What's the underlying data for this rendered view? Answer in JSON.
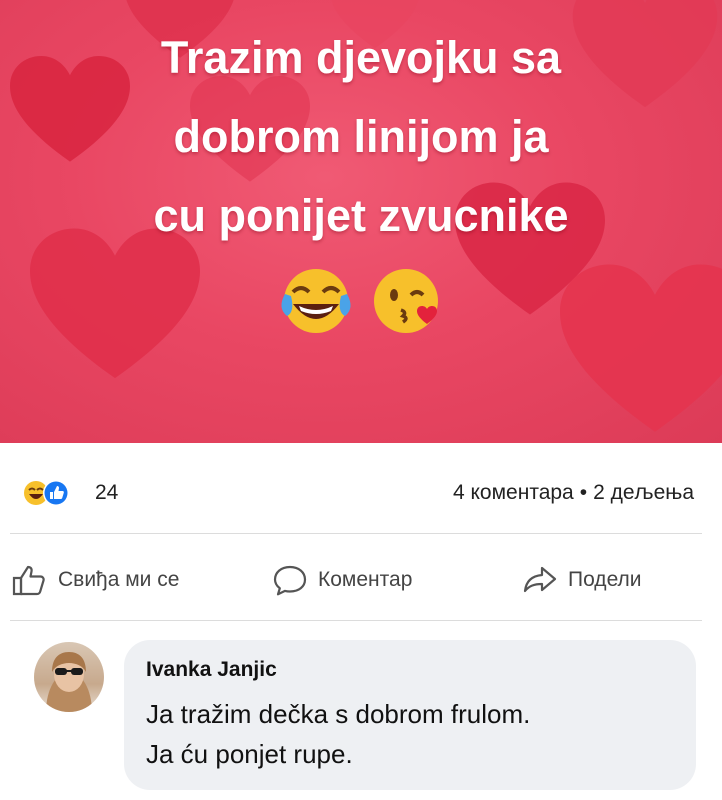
{
  "post": {
    "image_text_lines": [
      "Trazim djevojku sa",
      "dobrom linijom ja",
      "cu ponijet zvucnike"
    ],
    "emojis": [
      "face-with-tears-of-joy-icon",
      "face-blowing-kiss-icon"
    ],
    "background_color": "#e94763"
  },
  "stats": {
    "reactions": [
      "haha-reaction-icon",
      "like-reaction-icon"
    ],
    "reaction_count": "24",
    "comments": "4 коментара",
    "separator": "•",
    "shares": "2 дељења"
  },
  "actions": {
    "like_label": "Свиђа ми се",
    "comment_label": "Коментар",
    "share_label": "Подели"
  },
  "comment": {
    "author": "Ivanka Janjic",
    "lines": [
      "Ja tražim dečka s dobrom frulom.",
      "Ja ću ponjet rupe."
    ]
  }
}
